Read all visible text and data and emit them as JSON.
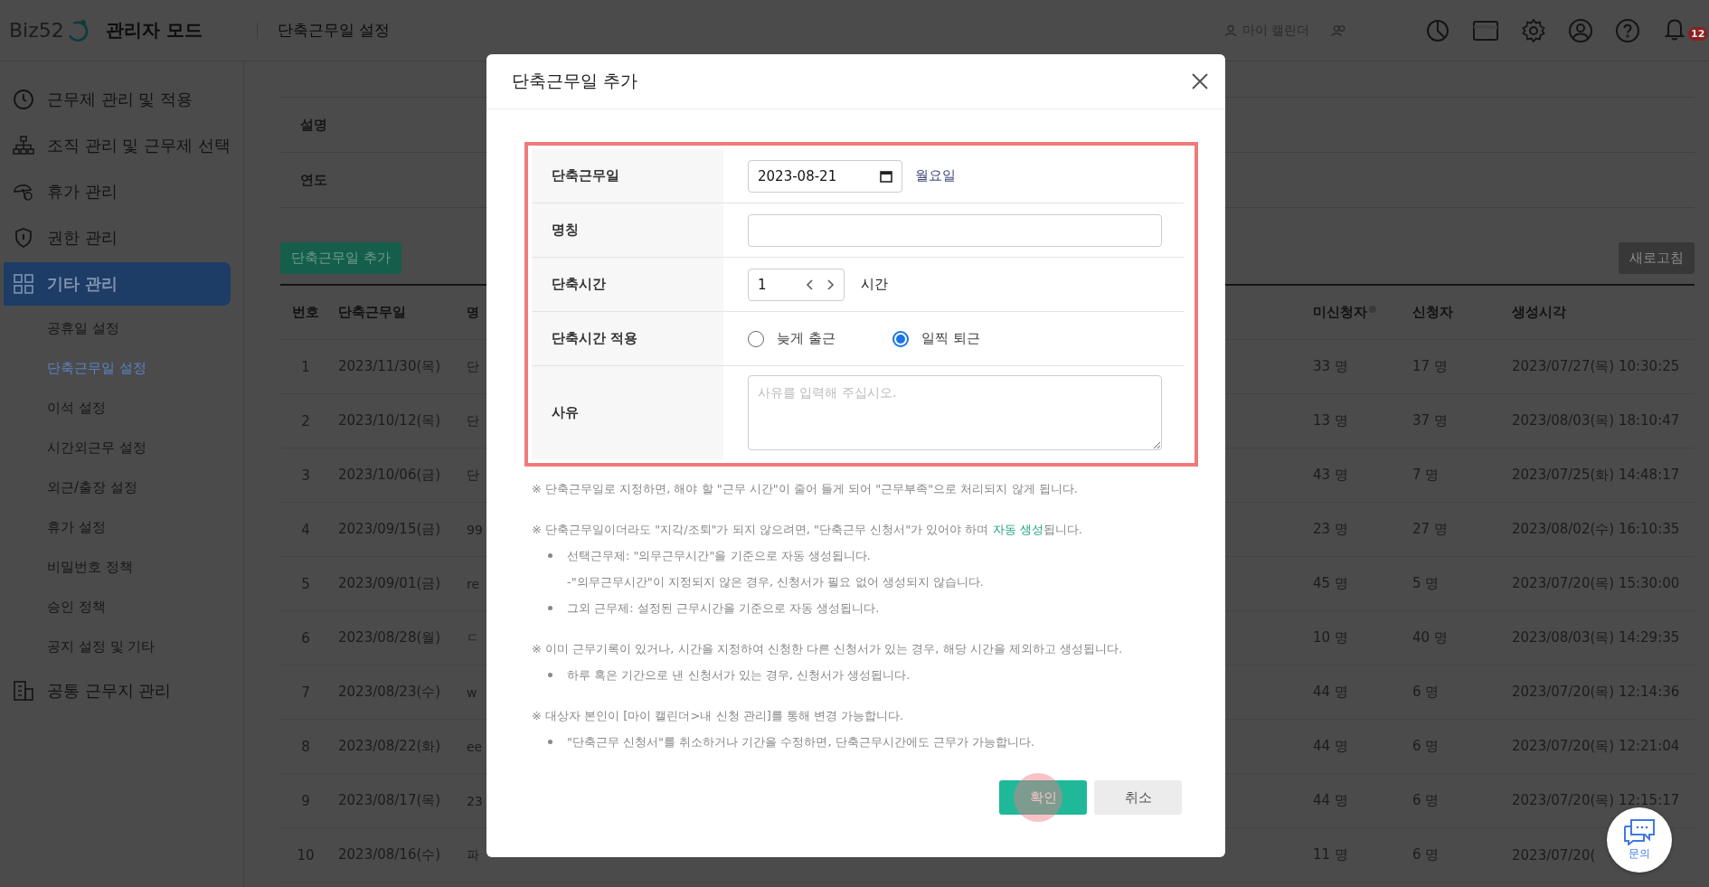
{
  "header": {
    "logo": "Biz52",
    "mode": "관리자 모드",
    "page_title": "단축근무일 설정",
    "calendar_link": "마이 캘린더",
    "notification_badge": "12"
  },
  "sidebar": {
    "items": [
      {
        "label": "근무제 관리 및 적용",
        "selected": false
      },
      {
        "label": "조직 관리 및 근무제 선택",
        "selected": false
      },
      {
        "label": "휴가 관리",
        "selected": false
      },
      {
        "label": "권한 관리",
        "selected": false
      },
      {
        "label": "기타 관리",
        "selected": true,
        "children": [
          {
            "label": "공휴일 설정",
            "selected": false
          },
          {
            "label": "단축근무일 설정",
            "selected": true
          },
          {
            "label": "이석 설정",
            "selected": false
          },
          {
            "label": "시간외근무 설정",
            "selected": false
          },
          {
            "label": "외근/출장 설정",
            "selected": false
          },
          {
            "label": "휴가 설정",
            "selected": false
          },
          {
            "label": "비밀번호 정책",
            "selected": false
          },
          {
            "label": "승인 정책",
            "selected": false
          },
          {
            "label": "공지 설정 및 기타",
            "selected": false
          }
        ]
      },
      {
        "label": "공통 근무지 관리",
        "selected": false
      }
    ]
  },
  "filters": [
    {
      "label": "설명"
    },
    {
      "label": "연도"
    }
  ],
  "add_button": "단축근무일 추가",
  "refresh_button": "새로고침",
  "table": {
    "columns": [
      "번호",
      "단축근무일",
      "명",
      "미신청자",
      "신청자",
      "생성시각"
    ],
    "rows": [
      [
        "1",
        "2023/11/30(목)",
        "단",
        "33 명",
        "17 명",
        "2023/07/27(목) 10:30:25"
      ],
      [
        "2",
        "2023/10/12(목)",
        "단",
        "13 명",
        "37 명",
        "2023/08/03(목) 18:10:47"
      ],
      [
        "3",
        "2023/10/06(금)",
        "단",
        "43 명",
        "7 명",
        "2023/07/25(화) 14:48:17"
      ],
      [
        "4",
        "2023/09/15(금)",
        "99",
        "23 명",
        "27 명",
        "2023/08/02(수) 16:10:35"
      ],
      [
        "5",
        "2023/09/01(금)",
        "re",
        "45 명",
        "5 명",
        "2023/07/20(목) 15:30:00"
      ],
      [
        "6",
        "2023/08/28(월)",
        "ㄷ",
        "10 명",
        "40 명",
        "2023/08/03(목) 14:29:35"
      ],
      [
        "7",
        "2023/08/23(수)",
        "w",
        "44 명",
        "6 명",
        "2023/07/20(목) 12:14:36"
      ],
      [
        "8",
        "2023/08/22(화)",
        "ee",
        "44 명",
        "6 명",
        "2023/07/20(목) 12:21:04"
      ],
      [
        "9",
        "2023/08/17(목)",
        "23",
        "44 명",
        "6 명",
        "2023/07/20(목) 12:15:17"
      ],
      [
        "10",
        "2023/08/16(수)",
        "파",
        "11 명",
        "6 명",
        "2023/07/20("
      ]
    ]
  },
  "dialog": {
    "title": "단축근무일 추가",
    "fields": [
      {
        "kind": "date",
        "label": "단축근무일",
        "value": "2023-08-21",
        "weekday": "월요일"
      },
      {
        "kind": "text",
        "label": "명칭"
      },
      {
        "kind": "stepper",
        "label": "단축시간",
        "value": "1",
        "unit": "시간"
      },
      {
        "kind": "radio",
        "label": "단축시간 적용",
        "options": [
          {
            "label": "늦게 출근",
            "selected": false
          },
          {
            "label": "일찍 퇴근",
            "selected": true
          }
        ]
      },
      {
        "kind": "textarea",
        "label": "사유",
        "placeholder": "사유를 입력해 주십시오."
      }
    ],
    "notes": [
      {
        "parts": [
          {
            "kind": "plain",
            "text": "※ 단축근무일로 지정하면, 해야 할 \"근무 시간\"이 줄어 들게 되어 \"근무부족\"으로 처리되지 않게 됩니다."
          }
        ]
      },
      {
        "parts": [
          {
            "kind": "plain",
            "text": "※ 단축근무일이더라도 \"지각/조퇴\"가 되지 않으려면, \"단축근무 신청서\"가 있어야 하며 "
          },
          {
            "kind": "link",
            "text": "자동 생성"
          },
          {
            "kind": "plain",
            "text": "됩니다."
          }
        ],
        "bullets": [
          {
            "kind": "bullet",
            "text": "선택근무제: \"의무근무시간\"을 기준으로 자동 생성됩니다."
          },
          {
            "kind": "continuation",
            "text": "-\"의무근무시간\"이 지정되지 않은 경우, 신청서가 필요 없어 생성되지 않습니다."
          },
          {
            "kind": "bullet",
            "text": "그외 근무제: 설정된 근무시간을 기준으로 자동 생성됩니다."
          }
        ]
      },
      {
        "parts": [
          {
            "kind": "plain",
            "text": "※ 이미 근무기록이 있거나, 시간을 지정하여 신청한 다른 신청서가 있는 경우, 해당 시간을 제외하고 생성됩니다."
          }
        ],
        "bullets": [
          {
            "kind": "bullet",
            "text": "하루 혹은 기간으로 낸 신청서가 있는 경우, 신청서가 생성됩니다."
          }
        ]
      },
      {
        "parts": [
          {
            "kind": "plain",
            "text": "※ 대상자 본인이 [마이 캘린더>내 신청 관리]를 통해 변경 가능합니다."
          }
        ],
        "bullets": [
          {
            "kind": "bullet",
            "text": "\"단축근무 신청서\"를 취소하거나 기간을 수정하면, 단축근무시간에도 근무가 가능합니다."
          }
        ]
      }
    ],
    "buttons": [
      {
        "kind": "primary",
        "label": "확인"
      },
      {
        "kind": "secondary",
        "label": "취소"
      }
    ]
  },
  "chat_button": "문의"
}
